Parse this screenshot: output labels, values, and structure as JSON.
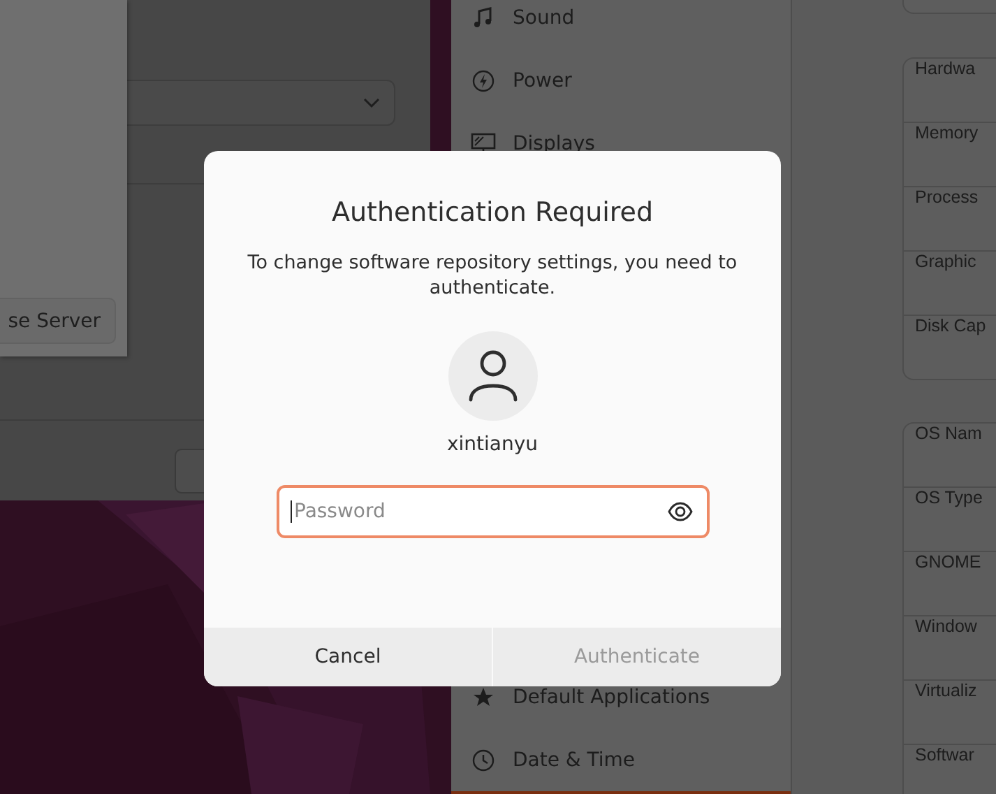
{
  "background_window": {
    "button": "se Server"
  },
  "settings": {
    "sidebar_items": [
      {
        "label": "Sound",
        "kind": "sound",
        "selected": false
      },
      {
        "label": "Power",
        "kind": "power",
        "selected": false
      },
      {
        "label": "Displays",
        "kind": "displays",
        "selected": false
      },
      {
        "label": "Default Applications",
        "kind": "star",
        "selected": false
      },
      {
        "label": "Date & Time",
        "kind": "clock",
        "selected": false
      },
      {
        "kind": "blank",
        "selected": true
      }
    ],
    "hardware_rows": [
      "Hardwa",
      "Memory",
      "Process",
      "Graphic",
      "Disk Cap"
    ],
    "os_rows": [
      "OS Nam",
      "OS Type",
      "GNOME",
      "Window",
      "Virtualiz",
      "Softwar"
    ]
  },
  "dialog": {
    "title": "Authentication Required",
    "message": "To change software repository settings, you need to authenticate.",
    "username": "xintianyu",
    "password": {
      "placeholder": "Password",
      "focused": true
    },
    "buttons": [
      {
        "label": "Cancel",
        "disabled": false
      },
      {
        "label": "Authenticate",
        "disabled": true
      }
    ]
  }
}
